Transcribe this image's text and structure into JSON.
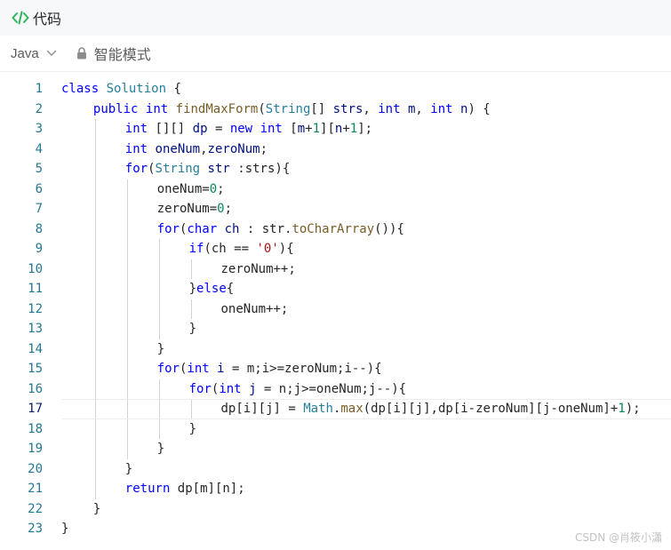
{
  "header": {
    "title": "代码",
    "icon": "code-brackets-icon",
    "accent": "#2db55d"
  },
  "toolbar": {
    "language": "Java",
    "mode_label": "智能模式",
    "lock_icon": "lock-icon",
    "chevron_icon": "chevron-down-icon"
  },
  "editor": {
    "active_line": 17,
    "lines": [
      {
        "n": "1",
        "indent": 0,
        "tokens": [
          [
            "k",
            "class"
          ],
          [
            "p",
            " "
          ],
          [
            "t",
            "Solution"
          ],
          [
            "p",
            " {"
          ]
        ]
      },
      {
        "n": "2",
        "indent": 1,
        "tokens": [
          [
            "k",
            "public"
          ],
          [
            "p",
            " "
          ],
          [
            "k",
            "int"
          ],
          [
            "p",
            " "
          ],
          [
            "f",
            "findMaxForm"
          ],
          [
            "p",
            "("
          ],
          [
            "t",
            "String"
          ],
          [
            "p",
            "[] "
          ],
          [
            "v",
            "strs"
          ],
          [
            "p",
            ", "
          ],
          [
            "k",
            "int"
          ],
          [
            "p",
            " "
          ],
          [
            "v",
            "m"
          ],
          [
            "p",
            ", "
          ],
          [
            "k",
            "int"
          ],
          [
            "p",
            " "
          ],
          [
            "v",
            "n"
          ],
          [
            "p",
            ") {"
          ]
        ]
      },
      {
        "n": "3",
        "indent": 2,
        "tokens": [
          [
            "k",
            "int"
          ],
          [
            "p",
            " [][] "
          ],
          [
            "v",
            "dp"
          ],
          [
            "p",
            " = "
          ],
          [
            "k",
            "new"
          ],
          [
            "p",
            " "
          ],
          [
            "k",
            "int"
          ],
          [
            "p",
            " ["
          ],
          [
            "v",
            "m"
          ],
          [
            "p",
            "+"
          ],
          [
            "n",
            "1"
          ],
          [
            "p",
            "]["
          ],
          [
            "v",
            "n"
          ],
          [
            "p",
            "+"
          ],
          [
            "n",
            "1"
          ],
          [
            "p",
            "];"
          ]
        ]
      },
      {
        "n": "4",
        "indent": 2,
        "tokens": [
          [
            "k",
            "int"
          ],
          [
            "p",
            " "
          ],
          [
            "v",
            "oneNum"
          ],
          [
            "p",
            ","
          ],
          [
            "v",
            "zeroNum"
          ],
          [
            "p",
            ";"
          ]
        ]
      },
      {
        "n": "5",
        "indent": 2,
        "tokens": [
          [
            "k",
            "for"
          ],
          [
            "p",
            "("
          ],
          [
            "t",
            "String"
          ],
          [
            "p",
            " "
          ],
          [
            "v",
            "str"
          ],
          [
            "p",
            " :strs){"
          ]
        ]
      },
      {
        "n": "6",
        "indent": 3,
        "tokens": [
          [
            "p",
            "oneNum="
          ],
          [
            "n",
            "0"
          ],
          [
            "p",
            ";"
          ]
        ]
      },
      {
        "n": "7",
        "indent": 3,
        "tokens": [
          [
            "p",
            "zeroNum="
          ],
          [
            "n",
            "0"
          ],
          [
            "p",
            ";"
          ]
        ]
      },
      {
        "n": "8",
        "indent": 3,
        "tokens": [
          [
            "k",
            "for"
          ],
          [
            "p",
            "("
          ],
          [
            "k",
            "char"
          ],
          [
            "p",
            " "
          ],
          [
            "v",
            "ch"
          ],
          [
            "p",
            " : str."
          ],
          [
            "f",
            "toCharArray"
          ],
          [
            "p",
            "()){"
          ]
        ]
      },
      {
        "n": "9",
        "indent": 4,
        "tokens": [
          [
            "k",
            "if"
          ],
          [
            "p",
            "(ch == "
          ],
          [
            "s",
            "'0'"
          ],
          [
            "p",
            "){"
          ]
        ]
      },
      {
        "n": "10",
        "indent": 5,
        "tokens": [
          [
            "p",
            "zeroNum++;"
          ]
        ]
      },
      {
        "n": "11",
        "indent": 4,
        "tokens": [
          [
            "p",
            "}"
          ],
          [
            "k",
            "else"
          ],
          [
            "p",
            "{"
          ]
        ]
      },
      {
        "n": "12",
        "indent": 5,
        "tokens": [
          [
            "p",
            "oneNum++;"
          ]
        ]
      },
      {
        "n": "13",
        "indent": 4,
        "tokens": [
          [
            "p",
            "}"
          ]
        ]
      },
      {
        "n": "14",
        "indent": 3,
        "tokens": [
          [
            "p",
            "}"
          ]
        ]
      },
      {
        "n": "15",
        "indent": 3,
        "tokens": [
          [
            "k",
            "for"
          ],
          [
            "p",
            "("
          ],
          [
            "k",
            "int"
          ],
          [
            "p",
            " "
          ],
          [
            "v",
            "i"
          ],
          [
            "p",
            " = m;i>=zeroNum;i--){"
          ]
        ]
      },
      {
        "n": "16",
        "indent": 4,
        "tokens": [
          [
            "k",
            "for"
          ],
          [
            "p",
            "("
          ],
          [
            "k",
            "int"
          ],
          [
            "p",
            " "
          ],
          [
            "v",
            "j"
          ],
          [
            "p",
            " = n;j>=oneNum;j--){"
          ]
        ]
      },
      {
        "n": "17",
        "indent": 5,
        "tokens": [
          [
            "p",
            "dp[i][j] = "
          ],
          [
            "t",
            "Math"
          ],
          [
            "p",
            "."
          ],
          [
            "f",
            "max"
          ],
          [
            "p",
            "(dp[i][j],dp[i-zeroNum][j-oneNum]+"
          ],
          [
            "n",
            "1"
          ],
          [
            "p",
            ");"
          ]
        ]
      },
      {
        "n": "18",
        "indent": 4,
        "tokens": [
          [
            "p",
            "}"
          ]
        ]
      },
      {
        "n": "19",
        "indent": 3,
        "tokens": [
          [
            "p",
            "}"
          ]
        ]
      },
      {
        "n": "20",
        "indent": 2,
        "tokens": [
          [
            "p",
            "}"
          ]
        ]
      },
      {
        "n": "21",
        "indent": 2,
        "tokens": [
          [
            "k",
            "return"
          ],
          [
            "p",
            " dp[m][n];"
          ]
        ]
      },
      {
        "n": "22",
        "indent": 1,
        "tokens": [
          [
            "p",
            "}"
          ]
        ]
      },
      {
        "n": "23",
        "indent": 0,
        "tokens": [
          [
            "p",
            "}"
          ]
        ]
      }
    ]
  },
  "watermark": "CSDN @肖筱小瀟",
  "colors": {
    "keyword": "#0000ff",
    "type": "#267f99",
    "number": "#098658",
    "string": "#a31515",
    "function": "#795e26",
    "line_number": "#237893"
  }
}
